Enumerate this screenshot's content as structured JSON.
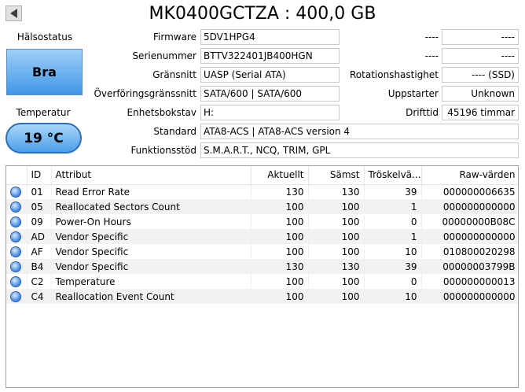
{
  "header": {
    "title": "MK0400GCTZA : 400,0 GB"
  },
  "health": {
    "label": "Hälsostatus",
    "value": "Bra",
    "color": "#3f96e6"
  },
  "temperature": {
    "label": "Temperatur",
    "value": "19 °C"
  },
  "details": {
    "firmware": {
      "label": "Firmware",
      "value": "5DV1HPG4"
    },
    "serial": {
      "label": "Serienummer",
      "value": "BTTV322401JB400HGN"
    },
    "interface": {
      "label": "Gränsnitt",
      "value": "UASP (Serial ATA)"
    },
    "transfer": {
      "label": "Överföringsgränssnitt",
      "value": "SATA/600 | SATA/600"
    },
    "drive_letter": {
      "label": "Enhetsbokstav",
      "value": "H:"
    },
    "standard": {
      "label": "Standard",
      "value": "ATA8-ACS | ATA8-ACS version 4"
    },
    "features": {
      "label": "Funktionsstöd",
      "value": "S.M.A.R.T., NCQ, TRIM, GPL"
    }
  },
  "right_details": {
    "blank1": {
      "label": "----",
      "value": "----"
    },
    "blank2": {
      "label": "----",
      "value": "----"
    },
    "rotation": {
      "label": "Rotationshastighet",
      "value": "---- (SSD)"
    },
    "power_on_count": {
      "label": "Uppstarter",
      "value": "Unknown"
    },
    "power_on_hours": {
      "label": "Drifttid",
      "value": "45196 timmar"
    }
  },
  "smart_table": {
    "headers": {
      "id": "ID",
      "attribute": "Attribut",
      "current": "Aktuellt",
      "worst": "Sämst",
      "threshold": "Tröskelvä...",
      "raw": "Raw-värden"
    },
    "rows": [
      {
        "id": "01",
        "attribute": "Read Error Rate",
        "current": "130",
        "worst": "130",
        "threshold": "39",
        "raw": "000000006635"
      },
      {
        "id": "05",
        "attribute": "Reallocated Sectors Count",
        "current": "100",
        "worst": "100",
        "threshold": "1",
        "raw": "000000000000"
      },
      {
        "id": "09",
        "attribute": "Power-On Hours",
        "current": "100",
        "worst": "100",
        "threshold": "0",
        "raw": "00000000B08C"
      },
      {
        "id": "AD",
        "attribute": "Vendor Specific",
        "current": "100",
        "worst": "100",
        "threshold": "1",
        "raw": "000000000000"
      },
      {
        "id": "AF",
        "attribute": "Vendor Specific",
        "current": "100",
        "worst": "100",
        "threshold": "10",
        "raw": "010800020298"
      },
      {
        "id": "B4",
        "attribute": "Vendor Specific",
        "current": "130",
        "worst": "130",
        "threshold": "39",
        "raw": "00000003799B"
      },
      {
        "id": "C2",
        "attribute": "Temperature",
        "current": "100",
        "worst": "100",
        "threshold": "0",
        "raw": "000000000013"
      },
      {
        "id": "C4",
        "attribute": "Reallocation Event Count",
        "current": "100",
        "worst": "100",
        "threshold": "10",
        "raw": "000000000000"
      }
    ]
  },
  "icons": {
    "status_dot": "status-good-icon",
    "prev": "triangle-left-icon"
  }
}
